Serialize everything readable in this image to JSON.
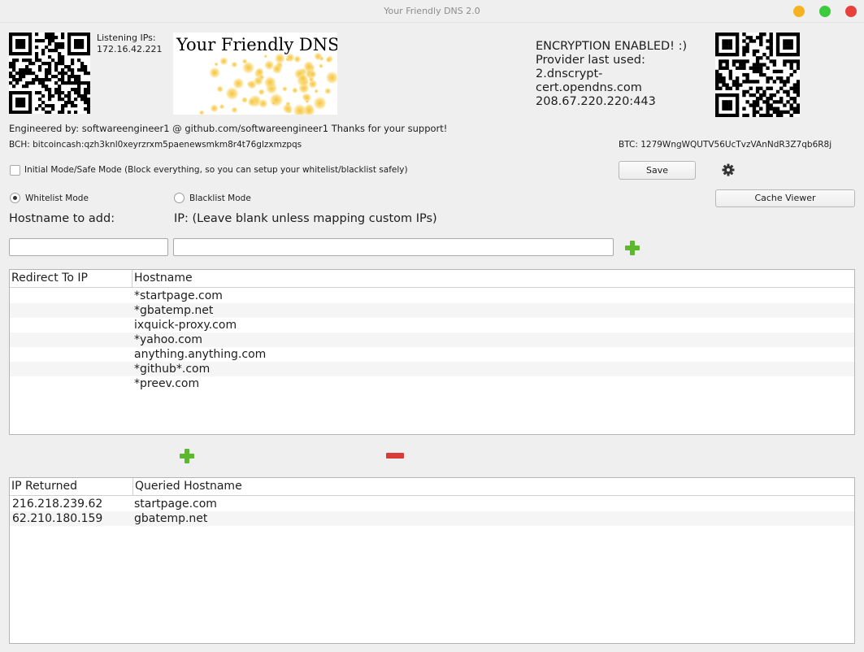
{
  "window": {
    "title": "Your Friendly DNS 2.0",
    "controls": {
      "minimize_color": "#f5b323",
      "maximize_color": "#3ccb3c",
      "close_color": "#e8413c"
    }
  },
  "header": {
    "listening_label": "Listening IPs:",
    "listening_ip": "172.16.42.221",
    "banner_title": "Your Friendly DNS!",
    "encryption": [
      "ENCRYPTION ENABLED! :)",
      "Provider last used:",
      "2.dnscrypt-",
      "cert.opendns.com",
      "208.67.220.220:443"
    ],
    "credits": "Engineered by: softwareengineer1 @ github.com/softwareengineer1 Thanks for your support!",
    "bch": "BCH: bitcoincash:qzh3knl0xeyrzrxm5paenewsmkm8r4t76glzxmzpqs",
    "btc": "BTC: 1279WngWQUTV56UcTvzVAnNdR3Z7qb6R8j"
  },
  "controls": {
    "initial_mode_label": "Initial Mode/Safe Mode (Block everything, so you can setup your whitelist/blacklist safely)",
    "initial_mode_checked": false,
    "save_label": "Save",
    "settings_icon": "gear-icon",
    "whitelist_label": "Whitelist Mode",
    "blacklist_label": "Blacklist Mode",
    "selected_mode": "whitelist",
    "cache_viewer_label": "Cache Viewer",
    "hostname_label": "Hostname to add:",
    "ip_label": "IP: (Leave blank unless mapping custom IPs)",
    "hostname_value": "",
    "ip_value": ""
  },
  "list_table": {
    "columns": [
      "Redirect To IP",
      "Hostname"
    ],
    "rows": [
      [
        "",
        "*startpage.com"
      ],
      [
        "",
        "*gbatemp.net"
      ],
      [
        "",
        "ixquick-proxy.com"
      ],
      [
        "",
        "*yahoo.com"
      ],
      [
        "",
        "anything.anything.com"
      ],
      [
        "",
        "*github*.com"
      ],
      [
        "",
        "*preev.com"
      ]
    ]
  },
  "cache_table": {
    "columns": [
      "IP Returned",
      "Queried Hostname"
    ],
    "rows": [
      [
        "216.218.239.62",
        "startpage.com"
      ],
      [
        "62.210.180.159",
        "gbatemp.net"
      ]
    ]
  }
}
